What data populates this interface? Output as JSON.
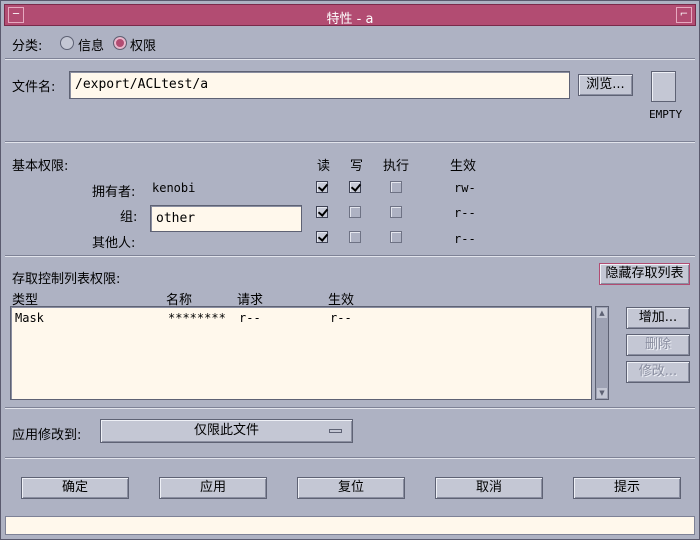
{
  "window": {
    "title": "特性 - a"
  },
  "category": {
    "label": "分类:",
    "options": [
      "信息",
      "权限"
    ],
    "selected": "权限"
  },
  "file": {
    "label": "文件名:",
    "value": "/export/ACLtest/a",
    "browse_label": "浏览...",
    "badge": "EMPTY"
  },
  "basic": {
    "label": "基本权限:",
    "headers": {
      "read": "读",
      "write": "写",
      "exec": "执行",
      "effective": "生效"
    },
    "owner": {
      "label": "拥有者:",
      "value": "kenobi",
      "read": true,
      "write": true,
      "exec": false,
      "effective": "rw-"
    },
    "group": {
      "label": "组:",
      "value": "other",
      "read": true,
      "write": false,
      "exec": false,
      "effective": "r--"
    },
    "others": {
      "label": "其他人:",
      "read": true,
      "write": false,
      "exec": false,
      "effective": "r--"
    }
  },
  "acl": {
    "label": "存取控制列表权限:",
    "hide_label": "隐藏存取列表",
    "columns": {
      "type": "类型",
      "name": "名称",
      "request": "请求",
      "effective": "生效"
    },
    "rows": [
      {
        "type": "Mask",
        "name": "********",
        "request": "r--",
        "effective": "r--"
      }
    ],
    "add_label": "增加...",
    "delete_label": "删除",
    "modify_label": "修改..."
  },
  "apply_to": {
    "label": "应用修改到:",
    "value": "仅限此文件"
  },
  "buttons": {
    "ok": "确定",
    "apply": "应用",
    "reset": "复位",
    "cancel": "取消",
    "help": "提示"
  },
  "colors": {
    "titlebar": "#b24c72",
    "background": "#aeb2c3",
    "field": "#fff8ec"
  }
}
